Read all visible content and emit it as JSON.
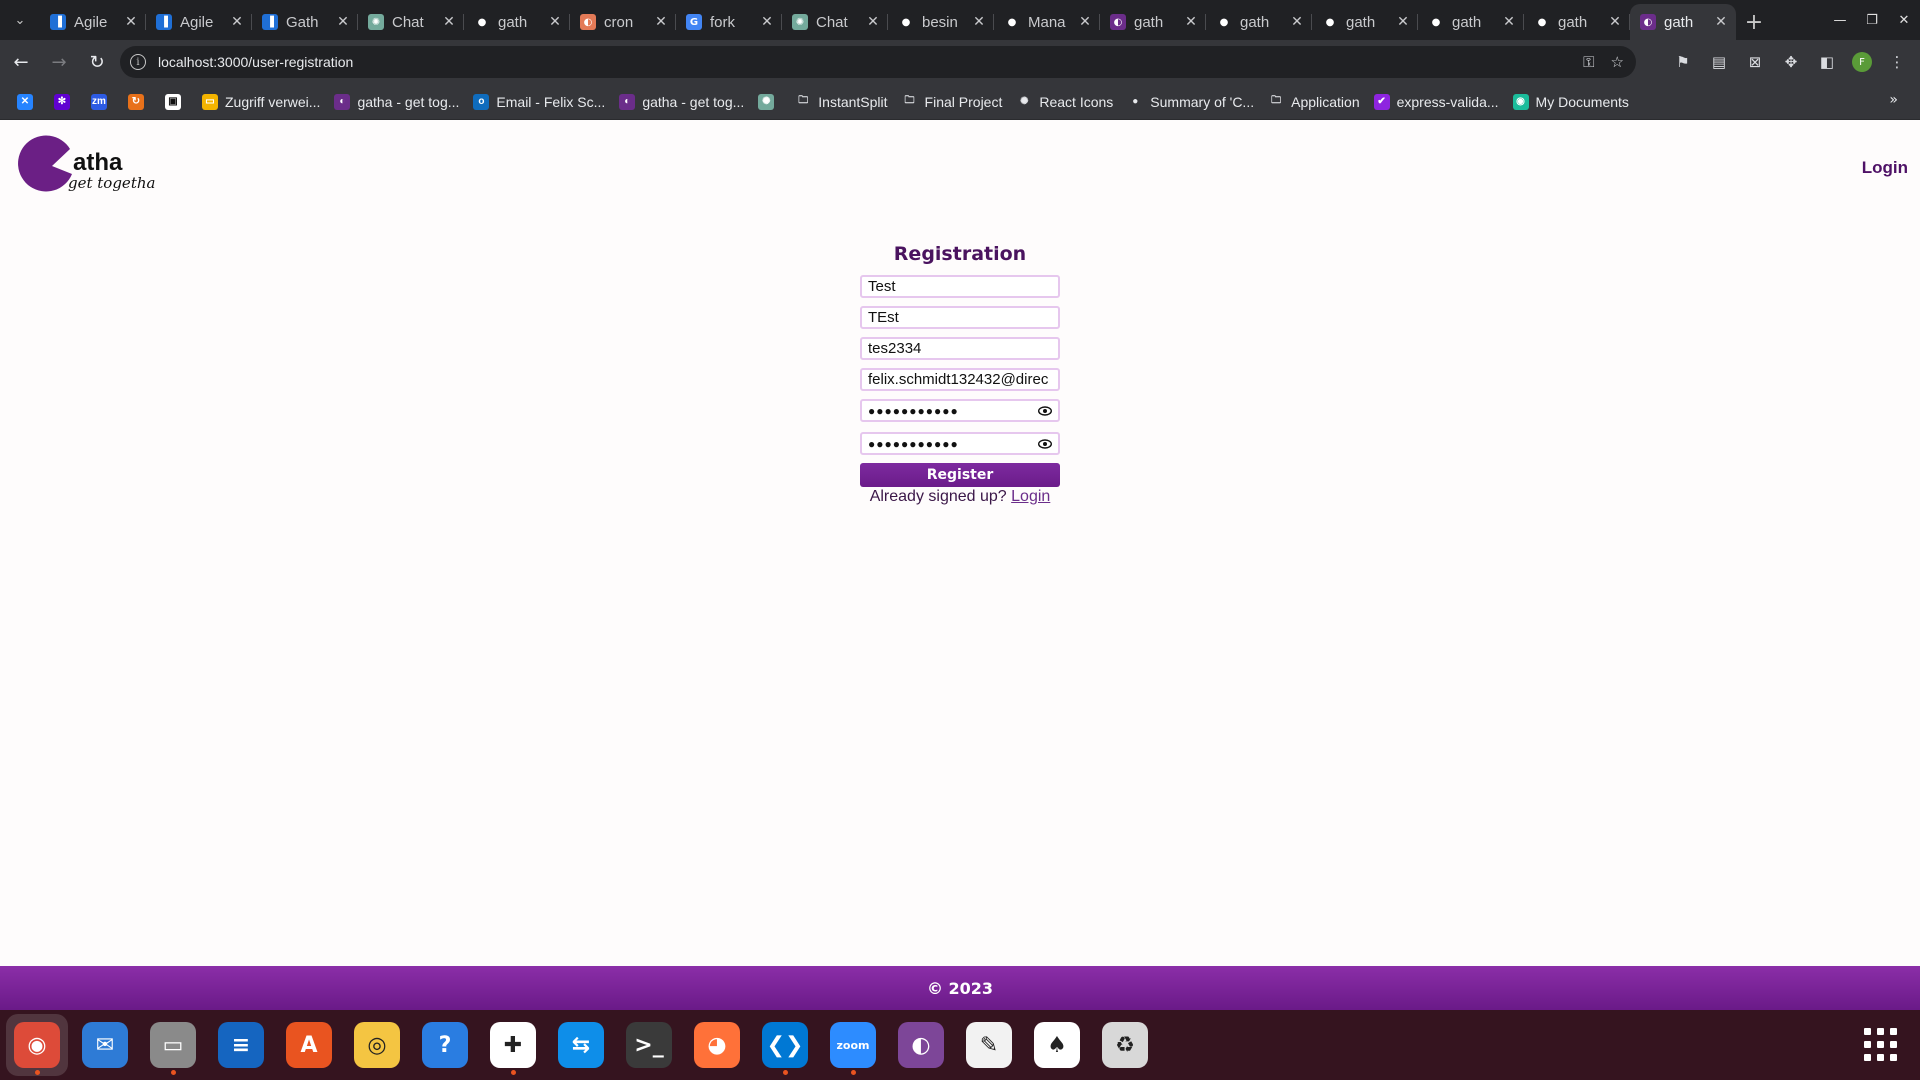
{
  "browser": {
    "tabs": [
      {
        "title": "Agile",
        "favicon": "trello-icon",
        "color": "#1f6fd6",
        "glyph": "▐"
      },
      {
        "title": "Agile",
        "favicon": "trello-icon",
        "color": "#1f6fd6",
        "glyph": "▐"
      },
      {
        "title": "Gath",
        "favicon": "trello-icon",
        "color": "#1f6fd6",
        "glyph": "▐"
      },
      {
        "title": "Chat",
        "favicon": "chatgpt-icon",
        "color": "#74aa9c",
        "glyph": "✺"
      },
      {
        "title": "gath",
        "favicon": "github-icon",
        "color": "#202124",
        "glyph": "●"
      },
      {
        "title": "cron",
        "favicon": "cron-icon",
        "color": "#e37a57",
        "glyph": "◐"
      },
      {
        "title": "fork",
        "favicon": "google-icon",
        "color": "#4285f4",
        "glyph": "G"
      },
      {
        "title": "Chat",
        "favicon": "chatgpt-icon",
        "color": "#74aa9c",
        "glyph": "✺"
      },
      {
        "title": "besin",
        "favicon": "github-icon",
        "color": "#202124",
        "glyph": "●"
      },
      {
        "title": "Mana",
        "favicon": "github-icon",
        "color": "#202124",
        "glyph": "●"
      },
      {
        "title": "gath",
        "favicon": "gatha-icon",
        "color": "#6b2d8a",
        "glyph": "◐"
      },
      {
        "title": "gath",
        "favicon": "github-icon",
        "color": "#202124",
        "glyph": "●"
      },
      {
        "title": "gath",
        "favicon": "github-icon",
        "color": "#202124",
        "glyph": "●"
      },
      {
        "title": "gath",
        "favicon": "github-icon",
        "color": "#202124",
        "glyph": "●"
      },
      {
        "title": "gath",
        "favicon": "github-icon",
        "color": "#202124",
        "glyph": "●"
      },
      {
        "title": "gath",
        "favicon": "gatha-icon",
        "color": "#6b2d8a",
        "glyph": "◐",
        "active": true
      }
    ],
    "url": "localhost:3000/user-registration",
    "bookmarks": [
      {
        "label": "",
        "icon": "jira-icon",
        "color": "#2684ff",
        "glyph": "✕"
      },
      {
        "label": "",
        "icon": "yahoo-icon",
        "color": "#6001d2",
        "glyph": "✻"
      },
      {
        "label": "",
        "icon": "zm-icon",
        "color": "#2d5be3",
        "glyph": "zm"
      },
      {
        "label": "",
        "icon": "refresh-bookmark-icon",
        "color": "#e8711a",
        "glyph": "↻"
      },
      {
        "label": "",
        "icon": "notion-icon",
        "color": "#ffffff",
        "glyph": "▣"
      },
      {
        "label": "Zugriff verwei...",
        "icon": "slides-icon",
        "color": "#f4b400",
        "glyph": "▭"
      },
      {
        "label": "gatha - get tog...",
        "icon": "gatha-icon",
        "color": "#6b2d8a",
        "glyph": "◐"
      },
      {
        "label": "Email - Felix Sc...",
        "icon": "outlook-icon",
        "color": "#0f6cbd",
        "glyph": "o"
      },
      {
        "label": "gatha - get tog...",
        "icon": "gatha-icon",
        "color": "#6b2d8a",
        "glyph": "◐"
      },
      {
        "label": "",
        "icon": "chatgpt-icon",
        "color": "#74aa9c",
        "glyph": "✺"
      },
      {
        "label": "InstantSplit",
        "icon": "folder-icon",
        "color": "transparent",
        "glyph": "🗀"
      },
      {
        "label": "Final Project",
        "icon": "folder-icon",
        "color": "transparent",
        "glyph": "🗀"
      },
      {
        "label": "React Icons",
        "icon": "react-icon",
        "color": "transparent",
        "glyph": "✺"
      },
      {
        "label": "Summary of 'C...",
        "icon": "github-icon",
        "color": "transparent",
        "glyph": "●"
      },
      {
        "label": "Application",
        "icon": "folder-icon",
        "color": "transparent",
        "glyph": "🗀"
      },
      {
        "label": "express-valida...",
        "icon": "check-icon",
        "color": "#8e24e0",
        "glyph": "✔"
      },
      {
        "label": "My Documents",
        "icon": "docs-icon",
        "color": "#1bbc9b",
        "glyph": "◉"
      }
    ]
  },
  "page": {
    "logo_main": "atha",
    "logo_sub": "get togetha",
    "nav_login": "Login",
    "form": {
      "title": "Registration",
      "first_name": "Test",
      "last_name": "TEst",
      "username": "tes2334",
      "email": "felix.schmidt132432@direc",
      "password_mask": "●●●●●●●●●●●",
      "confirm_mask": "●●●●●●●●●●●",
      "register_label": "Register",
      "signed_up_text": "Already signed up?",
      "login_link": "Login"
    },
    "footer": "© 2023"
  },
  "dock": [
    {
      "name": "chrome",
      "color": "#dd4b39",
      "glyph": "◉",
      "running": true
    },
    {
      "name": "thunderbird",
      "color": "#2e7bd6",
      "glyph": "✉"
    },
    {
      "name": "files",
      "color": "#8a8a8a",
      "glyph": "▭",
      "dot": true
    },
    {
      "name": "writer",
      "color": "#1565c0",
      "glyph": "≡"
    },
    {
      "name": "app-store",
      "color": "#e95420",
      "glyph": "A"
    },
    {
      "name": "rhythmbox",
      "color": "#f4c542",
      "glyph": "◎"
    },
    {
      "name": "help",
      "color": "#2a7de1",
      "glyph": "?"
    },
    {
      "name": "slack",
      "color": "#ffffff",
      "glyph": "✚",
      "dot": true
    },
    {
      "name": "teamviewer",
      "color": "#0e8ee9",
      "glyph": "⇆"
    },
    {
      "name": "terminal",
      "color": "#3a3a3a",
      "glyph": ">_"
    },
    {
      "name": "firefox",
      "color": "#ff7139",
      "glyph": "◕"
    },
    {
      "name": "vscode",
      "color": "#0078d4",
      "glyph": "❮❯",
      "dot": true
    },
    {
      "name": "zoom",
      "color": "#2d8cff",
      "glyph": "zoom",
      "dot": true
    },
    {
      "name": "tor",
      "color": "#7d4698",
      "glyph": "◐"
    },
    {
      "name": "text-editor",
      "color": "#f2f2f2",
      "glyph": "✎"
    },
    {
      "name": "mongodb",
      "color": "#ffffff",
      "glyph": "♠"
    },
    {
      "name": "trash",
      "color": "#d8d8d8",
      "glyph": "♻"
    }
  ]
}
